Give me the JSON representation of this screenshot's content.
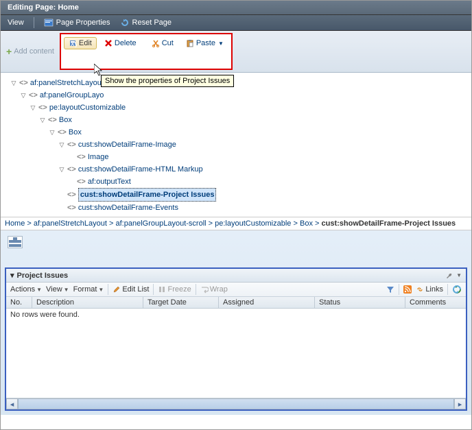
{
  "header": {
    "title": "Editing Page: Home"
  },
  "menubar": {
    "view": "View",
    "page_properties": "Page Properties",
    "reset_page": "Reset Page"
  },
  "main_toolbar": {
    "add_content": "Add content",
    "edit": "Edit",
    "delete": "Delete",
    "cut": "Cut",
    "paste": "Paste"
  },
  "tooltip": "Show the properties of Project Issues",
  "tree": {
    "n0": "af:panelStretchLayout",
    "n1": "af:panelGroupLayo",
    "n2": "pe:layoutCustomizable",
    "n3": "Box",
    "n4": "Box",
    "n5": "cust:showDetailFrame-Image",
    "n6": "Image",
    "n7": "cust:showDetailFrame-HTML Markup",
    "n8": "af:outputText",
    "n9": "cust:showDetailFrame-Project Issues",
    "n10": "cust:showDetailFrame-Events"
  },
  "breadcrumb": {
    "b0": "Home",
    "b1": "af:panelStretchLayout",
    "b2": "af:panelGroupLayout-scroll",
    "b3": "pe:layoutCustomizable",
    "b4": "Box",
    "b5": "cust:showDetailFrame-Project Issues",
    "sep": ">"
  },
  "panel": {
    "title": "Project Issues",
    "toolbar": {
      "actions": "Actions",
      "view": "View",
      "format": "Format",
      "edit_list": "Edit List",
      "freeze": "Freeze",
      "wrap": "Wrap",
      "links": "Links"
    },
    "columns": {
      "no": "No.",
      "description": "Description",
      "target_date": "Target Date",
      "assigned": "Assigned",
      "status": "Status",
      "comments": "Comments"
    },
    "empty": "No rows were found."
  }
}
